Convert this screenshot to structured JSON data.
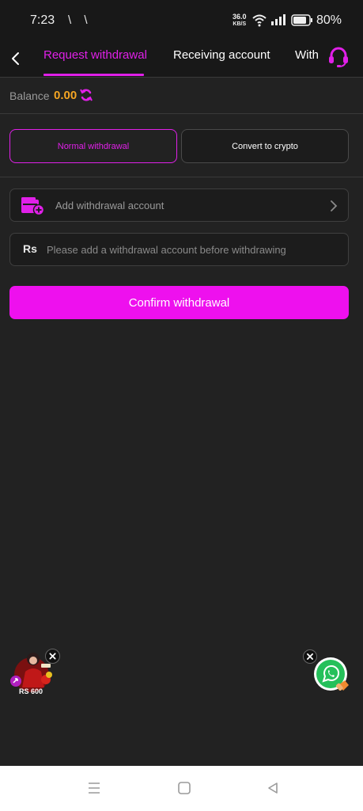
{
  "status_bar": {
    "time": "7:23",
    "app_icons": "\\ \\",
    "net_speed_value": "36.0",
    "net_speed_unit": "KB/S",
    "battery_percent": "80%"
  },
  "header": {
    "tabs": [
      {
        "label": "Request withdrawal",
        "active": true
      },
      {
        "label": "Receiving account",
        "active": false
      },
      {
        "label": "With",
        "active": false
      }
    ],
    "accent_color": "#e020e8"
  },
  "balance": {
    "label": "Balance",
    "value": "0.00"
  },
  "methods": {
    "normal_label": "Normal withdrawal",
    "crypto_label": "Convert to crypto",
    "selected": "Normal withdrawal"
  },
  "account": {
    "label": "Add withdrawal account"
  },
  "amount": {
    "currency_symbol": "Rs",
    "value": "",
    "placeholder": "Please add a withdrawal account before withdrawing"
  },
  "confirm": {
    "label": "Confirm withdrawal",
    "color": "#ee10ee"
  },
  "promo": {
    "amount_label": "RS 600"
  },
  "icons": [
    "back-icon",
    "headset-icon",
    "refresh-icon",
    "wallet-add-icon",
    "chevron-right-icon",
    "close-icon",
    "whatsapp-icon",
    "menu-icon",
    "home-icon",
    "back-triangle-icon"
  ]
}
